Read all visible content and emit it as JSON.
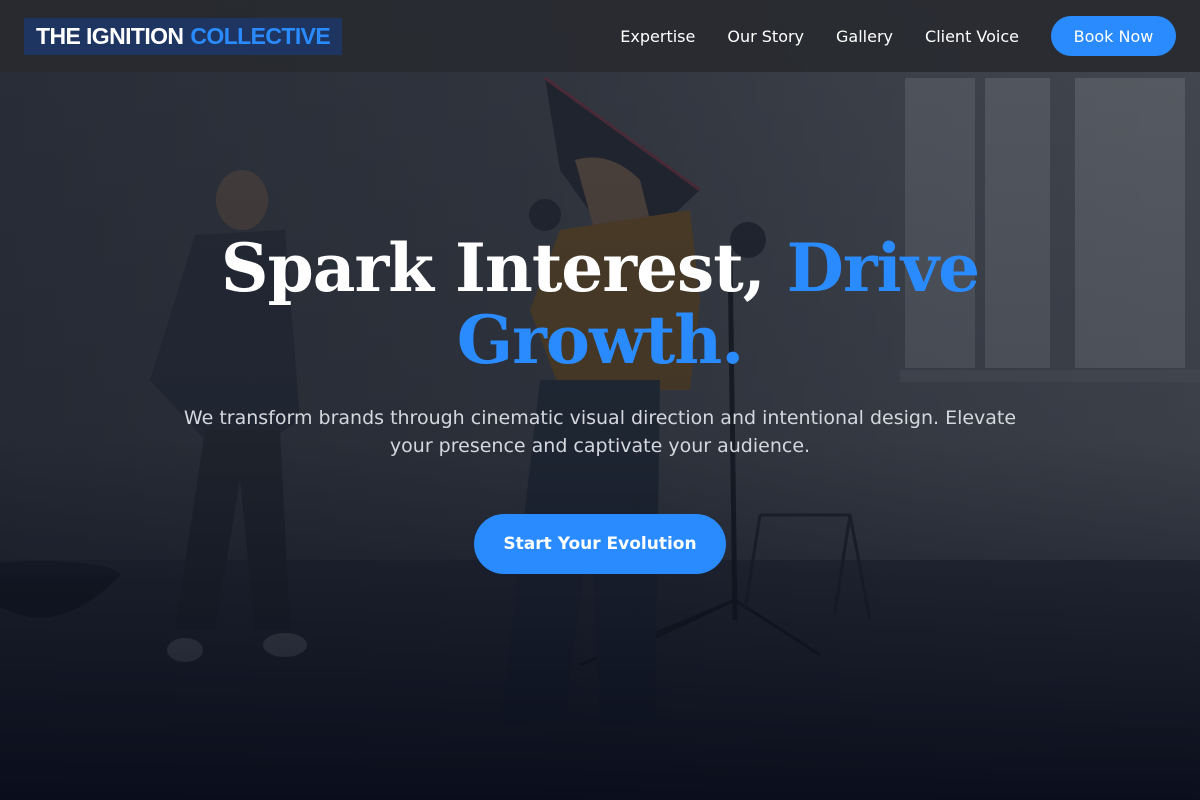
{
  "brand": {
    "name_part1": "THE IGNITION",
    "name_part2": "COLLECTIVE"
  },
  "nav": {
    "items": [
      {
        "label": "Expertise"
      },
      {
        "label": "Our Story"
      },
      {
        "label": "Gallery"
      },
      {
        "label": "Client Voice"
      }
    ],
    "book_label": "Book Now"
  },
  "hero": {
    "headline_plain": "Spark Interest,",
    "headline_accent": "Drive Growth.",
    "subtitle": "We transform brands through cinematic visual direction and intentional design. Elevate your presence and captivate your audience.",
    "cta_label": "Start Your Evolution",
    "background_image": "photo-studio-photographer-and-model"
  },
  "colors": {
    "accent": "#2a8bff",
    "header_bg": "#282a30",
    "logo_bg": "#1e3461",
    "text": "#ffffff",
    "subtitle_text": "#d4d7de"
  }
}
